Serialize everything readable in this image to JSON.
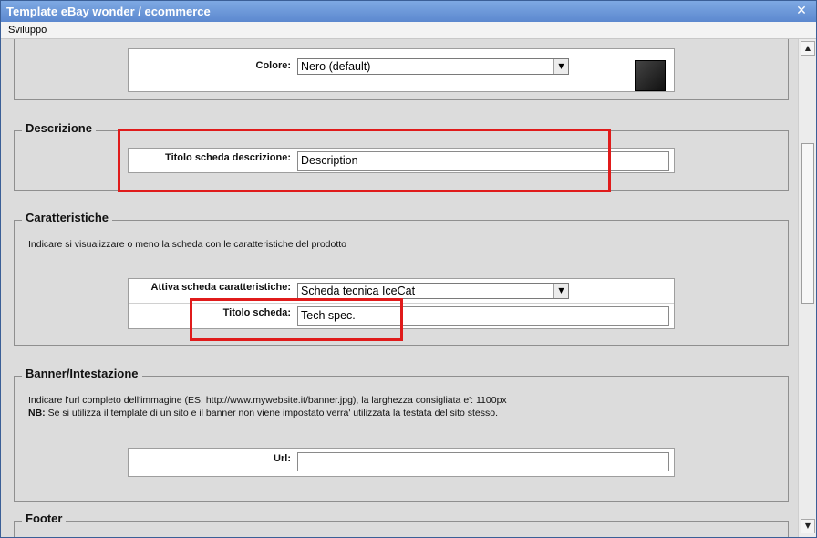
{
  "window": {
    "title": "Template eBay wonder / ecommerce",
    "close_glyph": "✕"
  },
  "menu": {
    "items": [
      "Sviluppo"
    ]
  },
  "colore": {
    "label": "Colore:",
    "value": "Nero (default)",
    "swatch_color": "#222222"
  },
  "descrizione": {
    "title": "Descrizione",
    "field_label": "Titolo scheda descrizione:",
    "field_value": "Description"
  },
  "caratteristiche": {
    "title": "Caratteristiche",
    "description": "Indicare si visualizzare o meno la scheda con le caratteristiche del prodotto",
    "attiva_label": "Attiva scheda caratteristiche:",
    "attiva_value": "Scheda tecnica IceCat",
    "titolo_label": "Titolo scheda:",
    "titolo_value": "Tech spec."
  },
  "banner": {
    "title": "Banner/Intestazione",
    "line1": "Indicare l'url completo dell'immagine (ES: http://www.mywebsite.it/banner.jpg), la larghezza consigliata e': 1100px",
    "nb_label": "NB:",
    "line2": " Se si utilizza il template di un sito e il banner non viene impostato verra' utilizzata la testata del sito stesso.",
    "url_label": "Url:",
    "url_value": ""
  },
  "footer": {
    "title": "Footer"
  },
  "icons": {
    "close": "close-icon",
    "dropdown": "chevron-down-icon",
    "scroll_up": "arrow-up-icon",
    "scroll_down": "arrow-down-icon"
  },
  "colors": {
    "highlight": "#e01b1b",
    "titlebar": "#6b97d8"
  }
}
